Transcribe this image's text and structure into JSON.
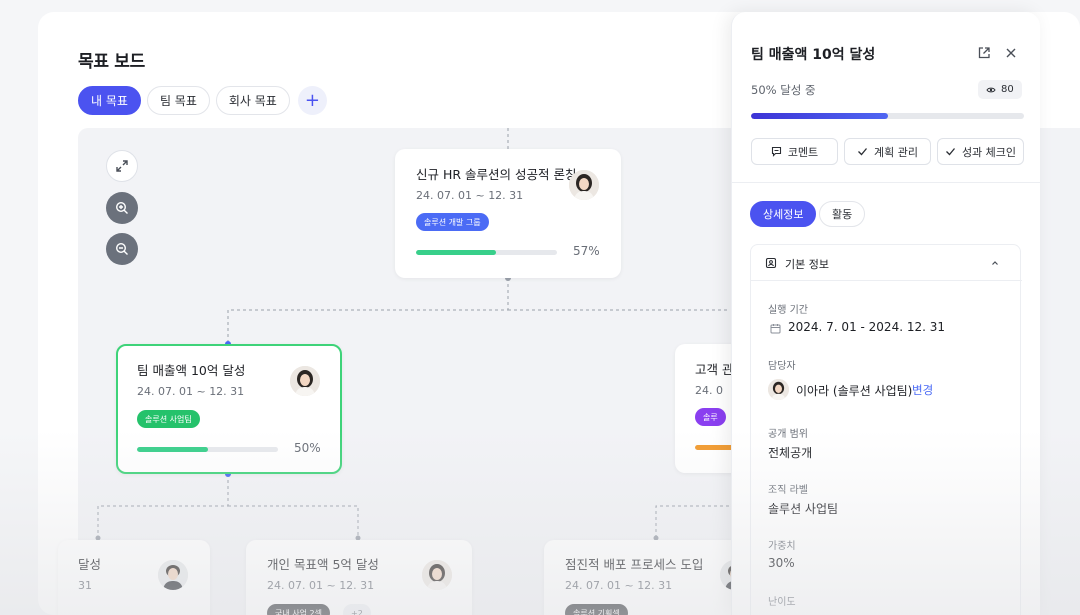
{
  "board": {
    "title": "목표 보드",
    "tabs": [
      {
        "label": "내 목표",
        "active": true
      },
      {
        "label": "팀 목표",
        "active": false
      },
      {
        "label": "회사 목표",
        "active": false
      }
    ],
    "add_tab_symbol": "+"
  },
  "cards": {
    "root": {
      "title": "신규 HR 솔루션의 성공적 론칭",
      "date": "24. 07. 01 ~ 12. 31",
      "tag": "솔루션 개발 그룹",
      "tag_color": "#4b6bf5",
      "progress": 0.57,
      "progress_label": "57%",
      "bar_color": "#38cf8a"
    },
    "selected": {
      "title": "팀 매출액 10억 달성",
      "date": "24. 07. 01 ~ 12. 31",
      "tag": "솔루션 사업팀",
      "tag_color": "#25c26b",
      "progress": 0.5,
      "progress_label": "50%",
      "bar_color": "#38cf8a"
    },
    "right_partial": {
      "title": "고객 관",
      "date": "24. 0",
      "tag": "솔루",
      "tag_color": "#8a3ff0",
      "bar_color": "#f29a2e"
    },
    "bottom_left_partial": {
      "title": "달성",
      "date": "31"
    },
    "bottom_mid": {
      "title": "개인 목표액 5억 달성",
      "date": "24. 07. 01 ~ 12. 31",
      "tag": "국내 사업 2셀",
      "tag_extra": "+2",
      "tag_color": "#2f3237"
    },
    "bottom_right": {
      "title": "점진적 배포 프로세스 도입",
      "date": "24. 07. 01 ~ 12. 31",
      "tag": "솔루션 기획셀",
      "tag_color": "#2f3237"
    }
  },
  "detail": {
    "title": "팀 매출액 10억 달성",
    "status": "50% 달성 중",
    "views": "80",
    "progress": 0.5,
    "actions": [
      "코멘트",
      "계획 관리",
      "성과 체크인"
    ],
    "tabs": [
      {
        "label": "상세정보",
        "active": true
      },
      {
        "label": "활동",
        "active": false
      }
    ],
    "section_title": "기본 정보",
    "fields": {
      "period_label": "실행 기간",
      "period_value": "2024. 7. 01 - 2024. 12. 31",
      "owner_label": "담당자",
      "owner_value": "이아라 (솔루션 사업팀)",
      "owner_change": "변경",
      "visibility_label": "공개 범위",
      "visibility_value": "전체공개",
      "org_label": "조직 라벨",
      "org_value": "솔루션 사업팀",
      "weight_label": "가중치",
      "weight_value": "30%",
      "difficulty_label": "난이도"
    }
  },
  "colors": {
    "accent": "#4b53f0",
    "selected_border": "#3ed379",
    "progress_green": "#38cf8a"
  }
}
